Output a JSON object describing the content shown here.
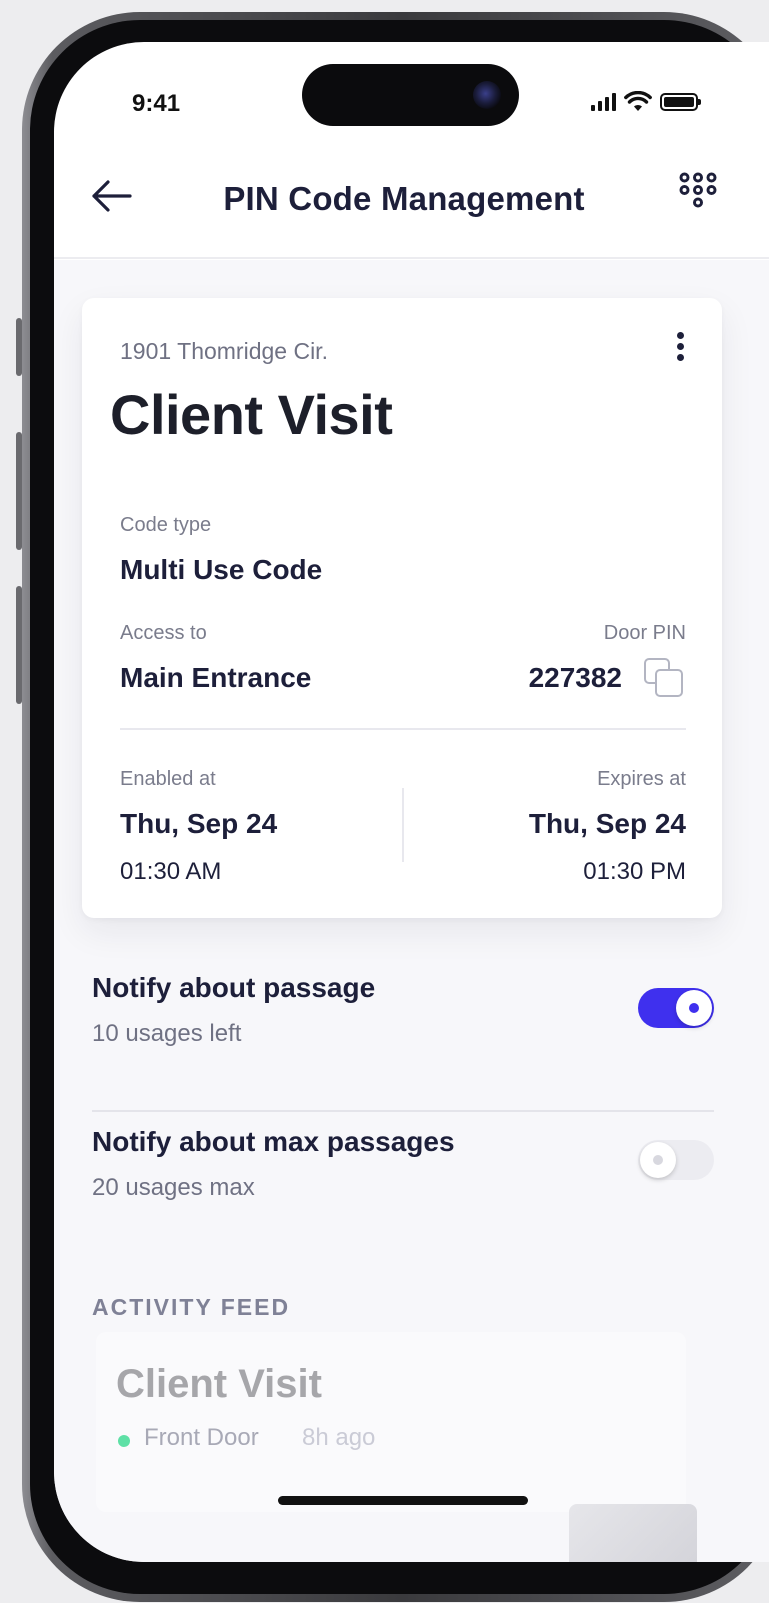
{
  "status_bar": {
    "time": "9:41"
  },
  "header": {
    "title": "PIN Code Management"
  },
  "card": {
    "address": "1901 Thomridge Cir.",
    "title": "Client Visit",
    "code_type_label": "Code type",
    "code_type_value": "Multi Use Code",
    "access_label": "Access to",
    "access_value": "Main Entrance",
    "door_pin_label": "Door PIN",
    "door_pin_value": "227382",
    "enabled_label": "Enabled at",
    "enabled_date": "Thu, Sep 24",
    "enabled_time": "01:30 AM",
    "expires_label": "Expires at",
    "expires_date": "Thu, Sep 24",
    "expires_time": "01:30 PM"
  },
  "settings": [
    {
      "title": "Notify about passage",
      "subtitle": "10 usages left",
      "enabled": true
    },
    {
      "title": "Notify about max passages",
      "subtitle": "20 usages max",
      "enabled": false
    }
  ],
  "activity": {
    "section_title": "ACTIVITY FEED",
    "items": [
      {
        "title": "Client Visit",
        "location": "Front Door",
        "time": "8h ago"
      }
    ]
  },
  "colors": {
    "accent": "#3f30ee",
    "text_primary": "#1d1f3a",
    "text_secondary": "#6f7183",
    "status_online": "#5ee0a6"
  }
}
